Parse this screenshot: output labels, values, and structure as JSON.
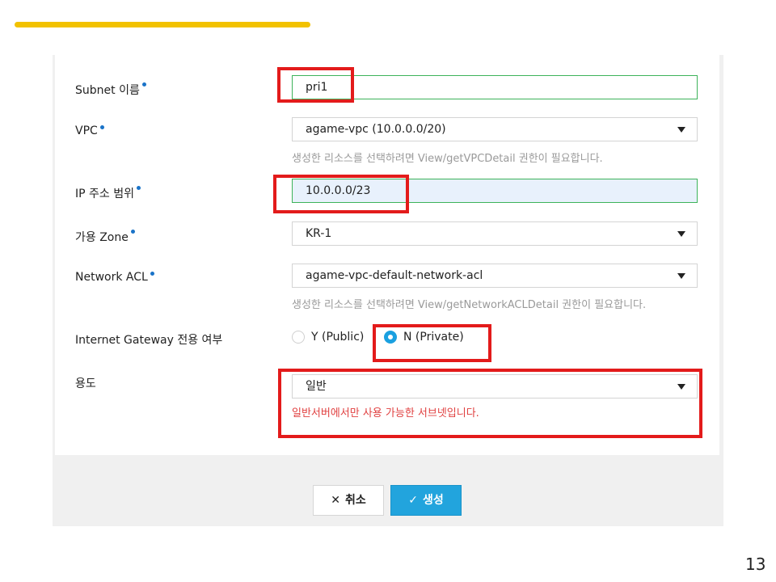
{
  "form": {
    "subnet_name": {
      "label": "Subnet 이름",
      "value": "pri1"
    },
    "vpc": {
      "label": "VPC",
      "value": "agame-vpc (10.0.0.0/20)",
      "hint": "생성한 리소스를 선택하려면 View/getVPCDetail 권한이 필요합니다."
    },
    "ip_range": {
      "label": "IP 주소 범위",
      "value": "10.0.0.0/23"
    },
    "zone": {
      "label": "가용 Zone",
      "value": "KR-1"
    },
    "network_acl": {
      "label": "Network ACL",
      "value": "agame-vpc-default-network-acl",
      "hint": "생성한 리소스를 선택하려면 View/getNetworkACLDetail 권한이 필요합니다."
    },
    "igw": {
      "label": "Internet Gateway 전용 여부",
      "options": [
        "Y (Public)",
        "N (Private)"
      ],
      "selected": "N (Private)"
    },
    "usage": {
      "label": "용도",
      "value": "일반",
      "hint": "일반서버에서만 사용 가능한 서브넷입니다."
    }
  },
  "buttons": {
    "cancel": "취소",
    "create": "생성"
  },
  "page_number": "13",
  "colors": {
    "accent_bar": "#f2c200",
    "required_dot": "#1a73c8",
    "primary_button": "#22a4dd",
    "highlight_box": "#e31b1b",
    "warning_text": "#e04040",
    "valid_border": "#3db35a"
  },
  "icons": {
    "cancel": "close-icon",
    "create": "check-icon",
    "dropdown": "chevron-down-icon"
  }
}
